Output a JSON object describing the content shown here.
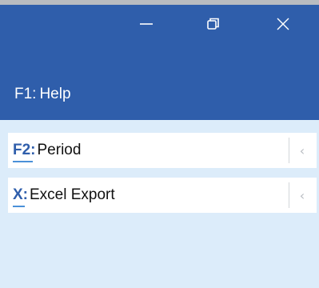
{
  "window": {
    "controls": {
      "minimize_icon": "minimize-icon",
      "restore_icon": "restore-icon",
      "close_icon": "close-icon"
    }
  },
  "header": {
    "help": {
      "key": "F1:",
      "label": "Help"
    }
  },
  "commands": [
    {
      "key": "F2:",
      "label": "Period",
      "chevron": "‹"
    },
    {
      "key": "X:",
      "label": "Excel Export",
      "chevron": "‹"
    }
  ],
  "colors": {
    "header_bg": "#2f5eab",
    "panel_bg": "#dcecfa",
    "key_color": "#2f5eab",
    "underline": "#4a90d9"
  }
}
